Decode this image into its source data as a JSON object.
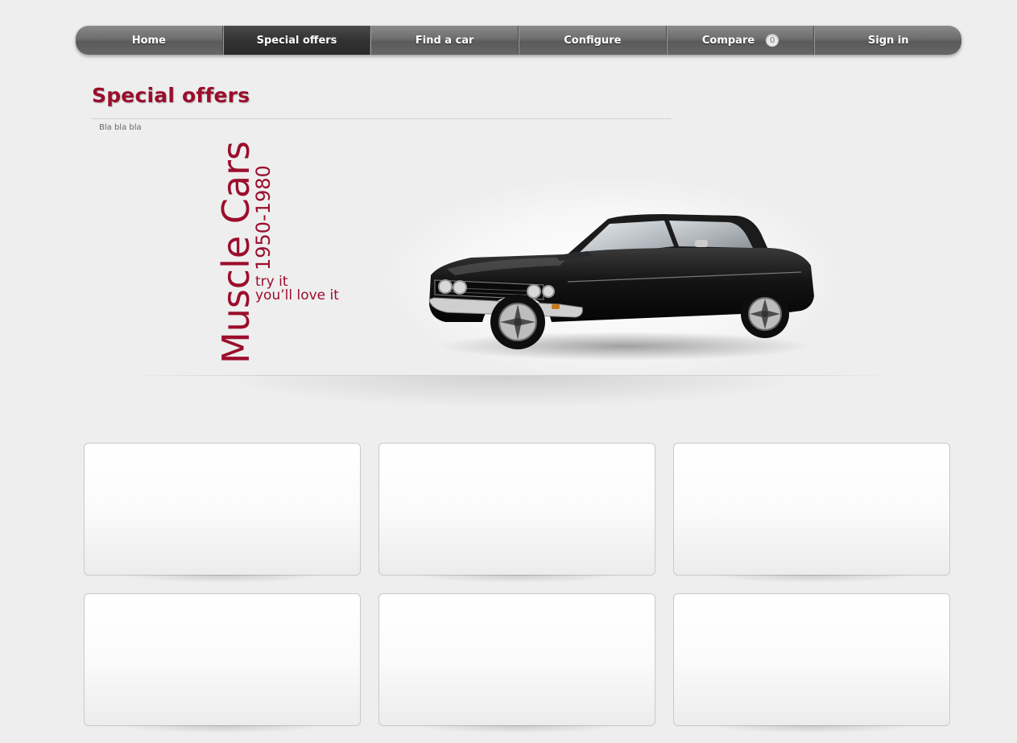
{
  "nav": {
    "items": [
      {
        "label": "Home",
        "active": false
      },
      {
        "label": "Special offers",
        "active": true
      },
      {
        "label": "Find a car",
        "active": false
      },
      {
        "label": "Configure",
        "active": false
      },
      {
        "label": "Compare",
        "active": false,
        "badge": "0"
      },
      {
        "label": "Sign in",
        "active": false
      }
    ]
  },
  "page": {
    "title": "Special offers",
    "subtitle": "Bla bla bla"
  },
  "banner": {
    "title": "Muscle Cars",
    "years": "1950-1980",
    "tagline_line1": "try it",
    "tagline_line2": "you’ll love it",
    "accent_color": "#9b0d2c"
  },
  "cards": [
    {
      "id": 1
    },
    {
      "id": 2
    },
    {
      "id": 3
    },
    {
      "id": 4
    },
    {
      "id": 5
    },
    {
      "id": 6
    }
  ]
}
